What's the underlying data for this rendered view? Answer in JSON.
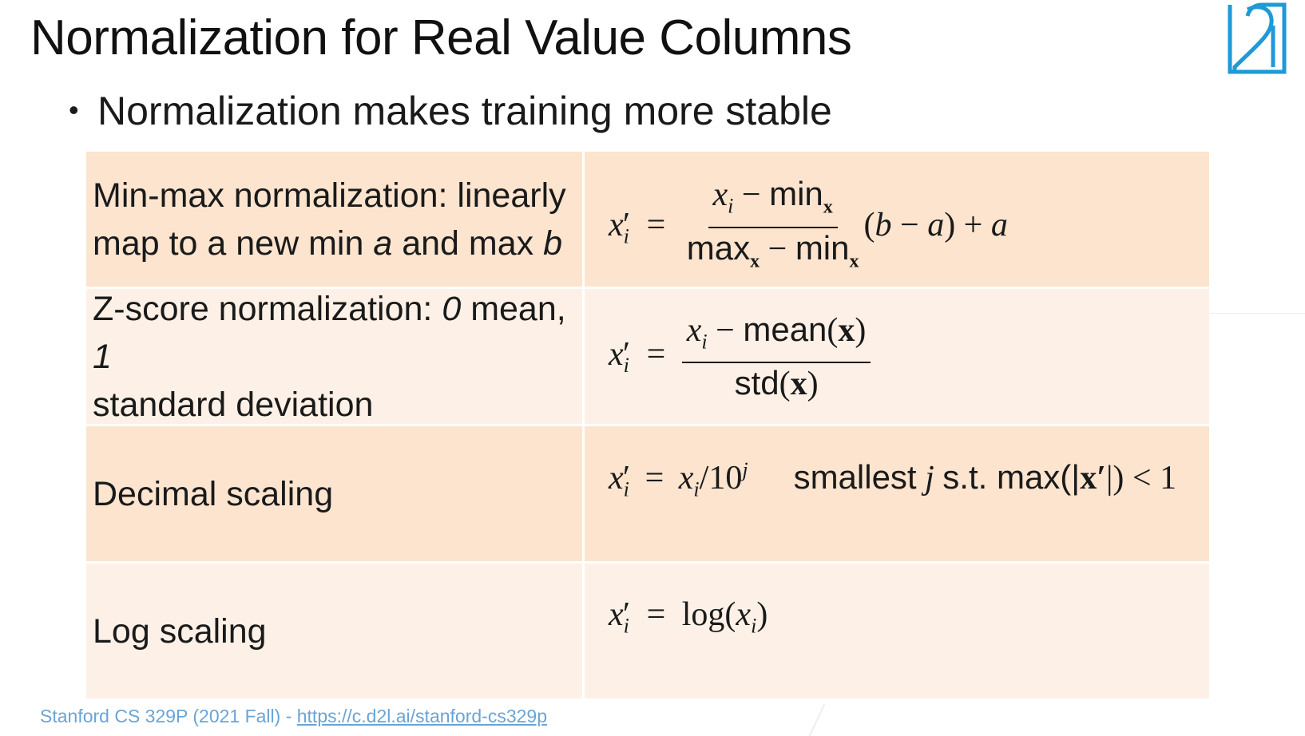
{
  "slide": {
    "title": "Normalization for Real Value Columns",
    "bullet": "Normalization makes training more stable"
  },
  "rows": [
    {
      "method_text": "Min-max normalization: linearly map to a new min",
      "var_a": "a",
      "and_max": "and max",
      "var_b": "b"
    },
    {
      "prefix": "Z-score normalization:",
      "zero": "0",
      "mean_text": "mean,",
      "one": "1",
      "rest": "standard deviation"
    },
    {
      "method": "Decimal scaling",
      "condition_prefix": "smallest",
      "condition_var": "j",
      "condition_mid": "s.t. max(|",
      "condition_bold": "x′",
      "condition_end": "|) < 1"
    },
    {
      "method": "Log scaling"
    }
  ],
  "footer": {
    "source": "Stanford CS 329P (2021 Fall) - ",
    "link": "https://c.d2l.ai/stanford-cs329p"
  },
  "colors": {
    "row_dark": "#fce4cf",
    "row_light": "#fdf1e7",
    "logo_blue": "#1e9ad6",
    "footer_text": "#6aa4d6"
  },
  "icons": [
    "d2l-logo-icon"
  ]
}
